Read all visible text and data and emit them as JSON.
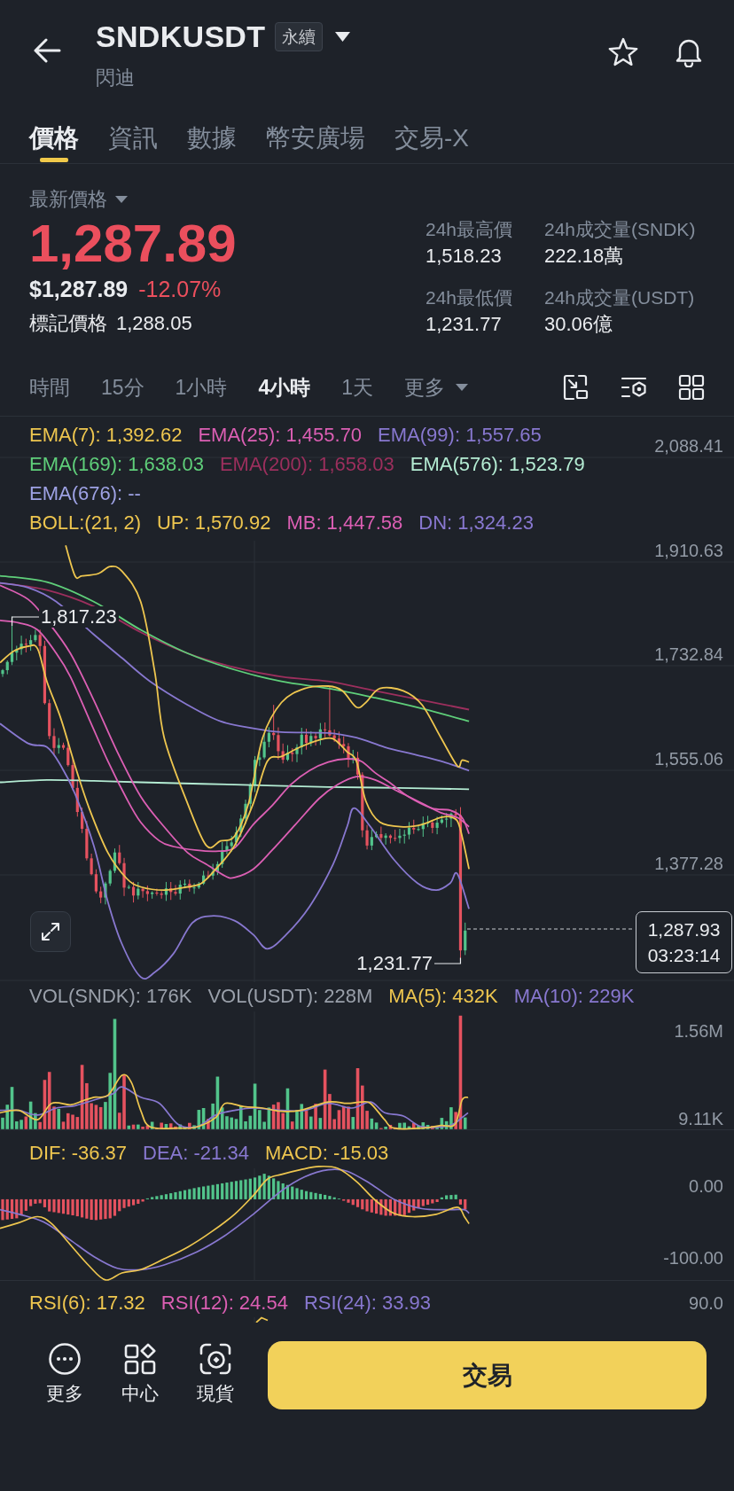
{
  "header": {
    "title": "SNDKUSDT",
    "badge": "永續",
    "subtitle": "閃迪"
  },
  "tabs": [
    {
      "label": "價格",
      "selected": true
    },
    {
      "label": "資訊",
      "selected": false
    },
    {
      "label": "數據",
      "selected": false
    },
    {
      "label": "幣安廣場",
      "selected": false
    },
    {
      "label": "交易-X",
      "selected": false
    }
  ],
  "ticker": {
    "price_type": "最新價格",
    "price": "1,287.89",
    "fiat_price": "$1,287.89",
    "change": "-12.07%",
    "mark_label": "標記價格",
    "mark_price": "1,288.05",
    "stats": [
      {
        "label": "24h最高價",
        "value": "1,518.23"
      },
      {
        "label": "24h成交量(SNDK)",
        "value": "222.18萬"
      },
      {
        "label": "24h最低價",
        "value": "1,231.77"
      },
      {
        "label": "24h成交量(USDT)",
        "value": "30.06億"
      }
    ]
  },
  "intervals": {
    "items": [
      {
        "label": "時間",
        "selected": false
      },
      {
        "label": "15分",
        "selected": false
      },
      {
        "label": "1小時",
        "selected": false
      },
      {
        "label": "4小時",
        "selected": true
      },
      {
        "label": "1天",
        "selected": false
      }
    ],
    "more_label": "更多"
  },
  "main_chart": {
    "legend_rows": [
      [
        {
          "label": "EMA(7): 1,392.62",
          "color": "#eec64f"
        },
        {
          "label": "EMA(25): 1,455.70",
          "color": "#dc5fb4"
        },
        {
          "label": "EMA(99): 1,557.65",
          "color": "#8878d0"
        }
      ],
      [
        {
          "label": "EMA(169): 1,638.03",
          "color": "#5fcf7a"
        },
        {
          "label": "EMA(200): 1,658.03",
          "color": "#9c2f5d"
        },
        {
          "label": "EMA(576): 1,523.79",
          "color": "#b4ecd3"
        }
      ],
      [
        {
          "label": "EMA(676): --",
          "color": "#9ea2e4"
        }
      ],
      [
        {
          "label": "BOLL:(21, 2)",
          "color": "#eec64f"
        },
        {
          "label": "UP: 1,570.92",
          "color": "#eec64f"
        },
        {
          "label": "MB: 1,447.58",
          "color": "#dc5fb4"
        },
        {
          "label": "DN: 1,324.23",
          "color": "#8878d0"
        }
      ]
    ],
    "price_axis": [
      "2,088.41",
      "1,910.63",
      "1,732.84",
      "1,555.06",
      "1,377.28"
    ],
    "high_label": "1,817.23",
    "low_label": "1,231.77",
    "last_price": "1,287.93",
    "countdown": "03:23:14"
  },
  "volume_chart": {
    "legend": [
      {
        "label": "VOL(SNDK): 176K",
        "color": "#9aa0aa"
      },
      {
        "label": "VOL(USDT): 228M",
        "color": "#9aa0aa"
      },
      {
        "label": "MA(5): 432K",
        "color": "#eec64f"
      },
      {
        "label": "MA(10): 229K",
        "color": "#8878d0"
      }
    ],
    "axis": [
      "1.56M",
      "9.11K"
    ]
  },
  "macd_chart": {
    "legend": [
      {
        "label": "DIF: -36.37",
        "color": "#eec64f"
      },
      {
        "label": "DEA: -21.34",
        "color": "#8878d0"
      },
      {
        "label": "MACD: -15.03",
        "color": "#eec64f"
      }
    ],
    "axis": [
      "0.00",
      "-100.00"
    ]
  },
  "rsi_chart": {
    "legend": [
      {
        "label": "RSI(6): 17.32",
        "color": "#eec64f"
      },
      {
        "label": "RSI(12): 24.54",
        "color": "#dc5fb4"
      },
      {
        "label": "RSI(24): 33.93",
        "color": "#8878d0"
      }
    ],
    "axis": [
      "90.0"
    ]
  },
  "bottom_bar": {
    "actions": [
      {
        "label": "更多",
        "kind": "more"
      },
      {
        "label": "中心",
        "kind": "hub"
      },
      {
        "label": "現貨",
        "kind": "spot"
      }
    ],
    "trade_button": "交易"
  }
}
